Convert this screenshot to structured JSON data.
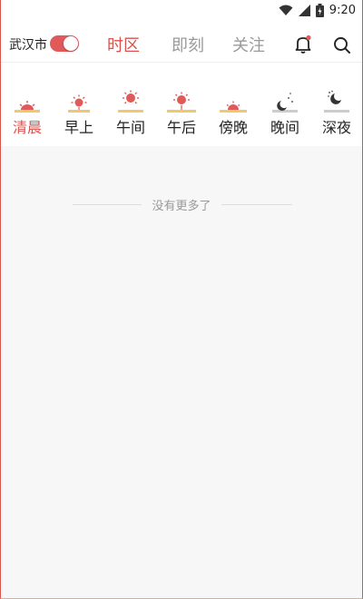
{
  "status_bar": {
    "time": "9:20"
  },
  "header": {
    "city": "武汉市",
    "toggle_on": true,
    "tabs": [
      {
        "label": "时区",
        "active": true
      },
      {
        "label": "即刻",
        "active": false
      },
      {
        "label": "关注",
        "active": false
      }
    ],
    "accent_color": "#d9534f"
  },
  "periods": [
    {
      "label": "清晨",
      "icon": "sunrise-icon",
      "active": true
    },
    {
      "label": "早上",
      "icon": "morning-sun-icon",
      "active": false
    },
    {
      "label": "午间",
      "icon": "noon-sun-icon",
      "active": false
    },
    {
      "label": "午后",
      "icon": "afternoon-sun-icon",
      "active": false
    },
    {
      "label": "傍晚",
      "icon": "sunset-icon",
      "active": false
    },
    {
      "label": "晚间",
      "icon": "evening-moon-icon",
      "active": false
    },
    {
      "label": "深夜",
      "icon": "night-moon-icon",
      "active": false
    }
  ],
  "feed": {
    "empty_message": "没有更多了"
  }
}
